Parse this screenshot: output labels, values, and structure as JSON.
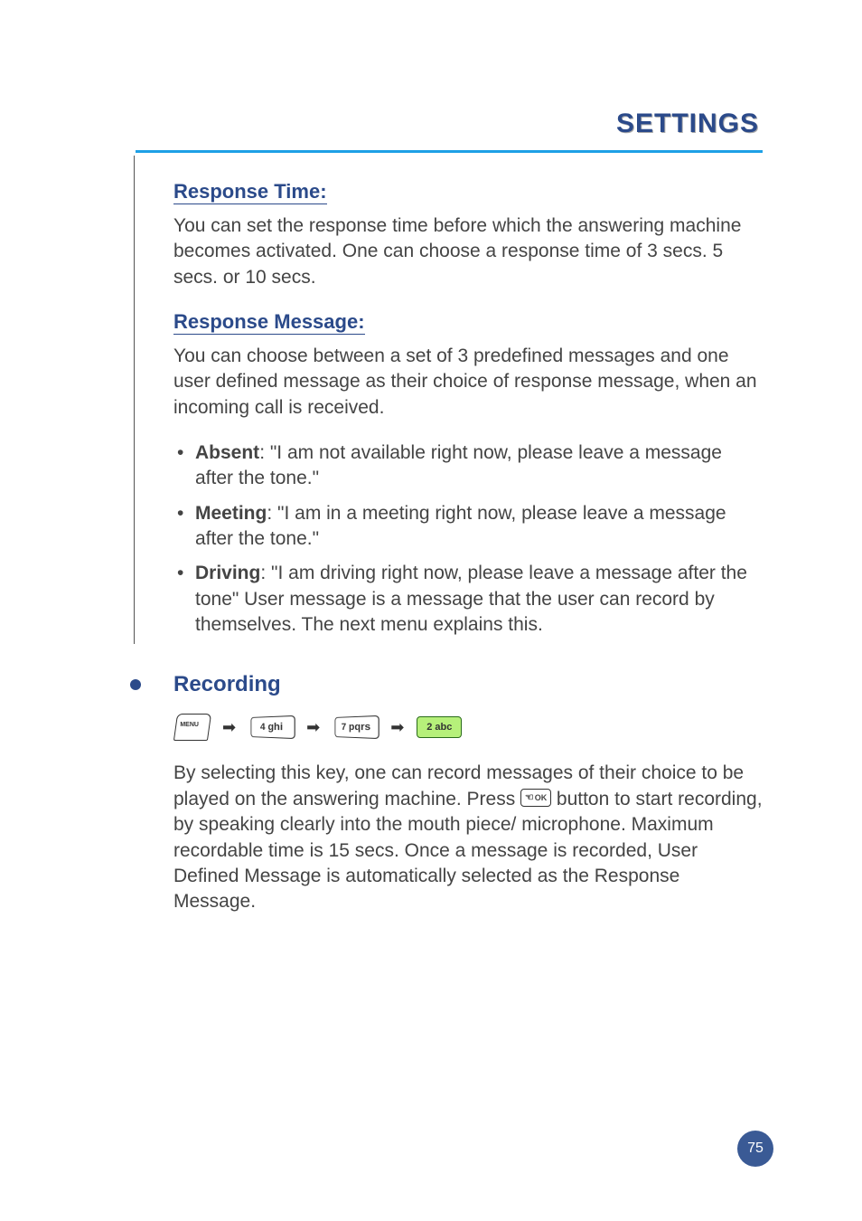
{
  "header": {
    "title": "SETTINGS"
  },
  "section_response_time": {
    "heading": "Response Time:",
    "body": "You can set the response time before which the answering machine becomes activated. One can choose a response time of 3 secs. 5 secs. or 10 secs."
  },
  "section_response_message": {
    "heading": "Response Message:",
    "intro": "You can choose between a set of 3 predefined messages and one user defined message as their choice of response message, when an incoming call is received.",
    "items": {
      "absent": {
        "label": "Absent",
        "text": ": \"I am not available right now, please leave a message after the tone.\""
      },
      "meeting": {
        "label": "Meeting",
        "text": ": \"I am in a meeting right now, please leave a message after the tone.\""
      },
      "driving": {
        "label": "Driving",
        "text": ": \"I am driving right now, please leave a message after the tone\" User message is a message that the user can record by themselves. The next menu explains this."
      }
    }
  },
  "section_recording": {
    "heading": "Recording",
    "keypath": {
      "k1": "4 ghi",
      "k2": "7 pqrs",
      "k3": "2 abc"
    },
    "body_pre": "By selecting this key, one can record messages of their choice to be played on the answering machine. Press ",
    "ok_label": "OK",
    "body_post": " button to start recording, by speaking clearly into the mouth piece/ microphone. Maximum recordable time is 15 secs. Once a message is recorded, User Defined Message is automatically selected as the Response Message."
  },
  "page_number": "75"
}
